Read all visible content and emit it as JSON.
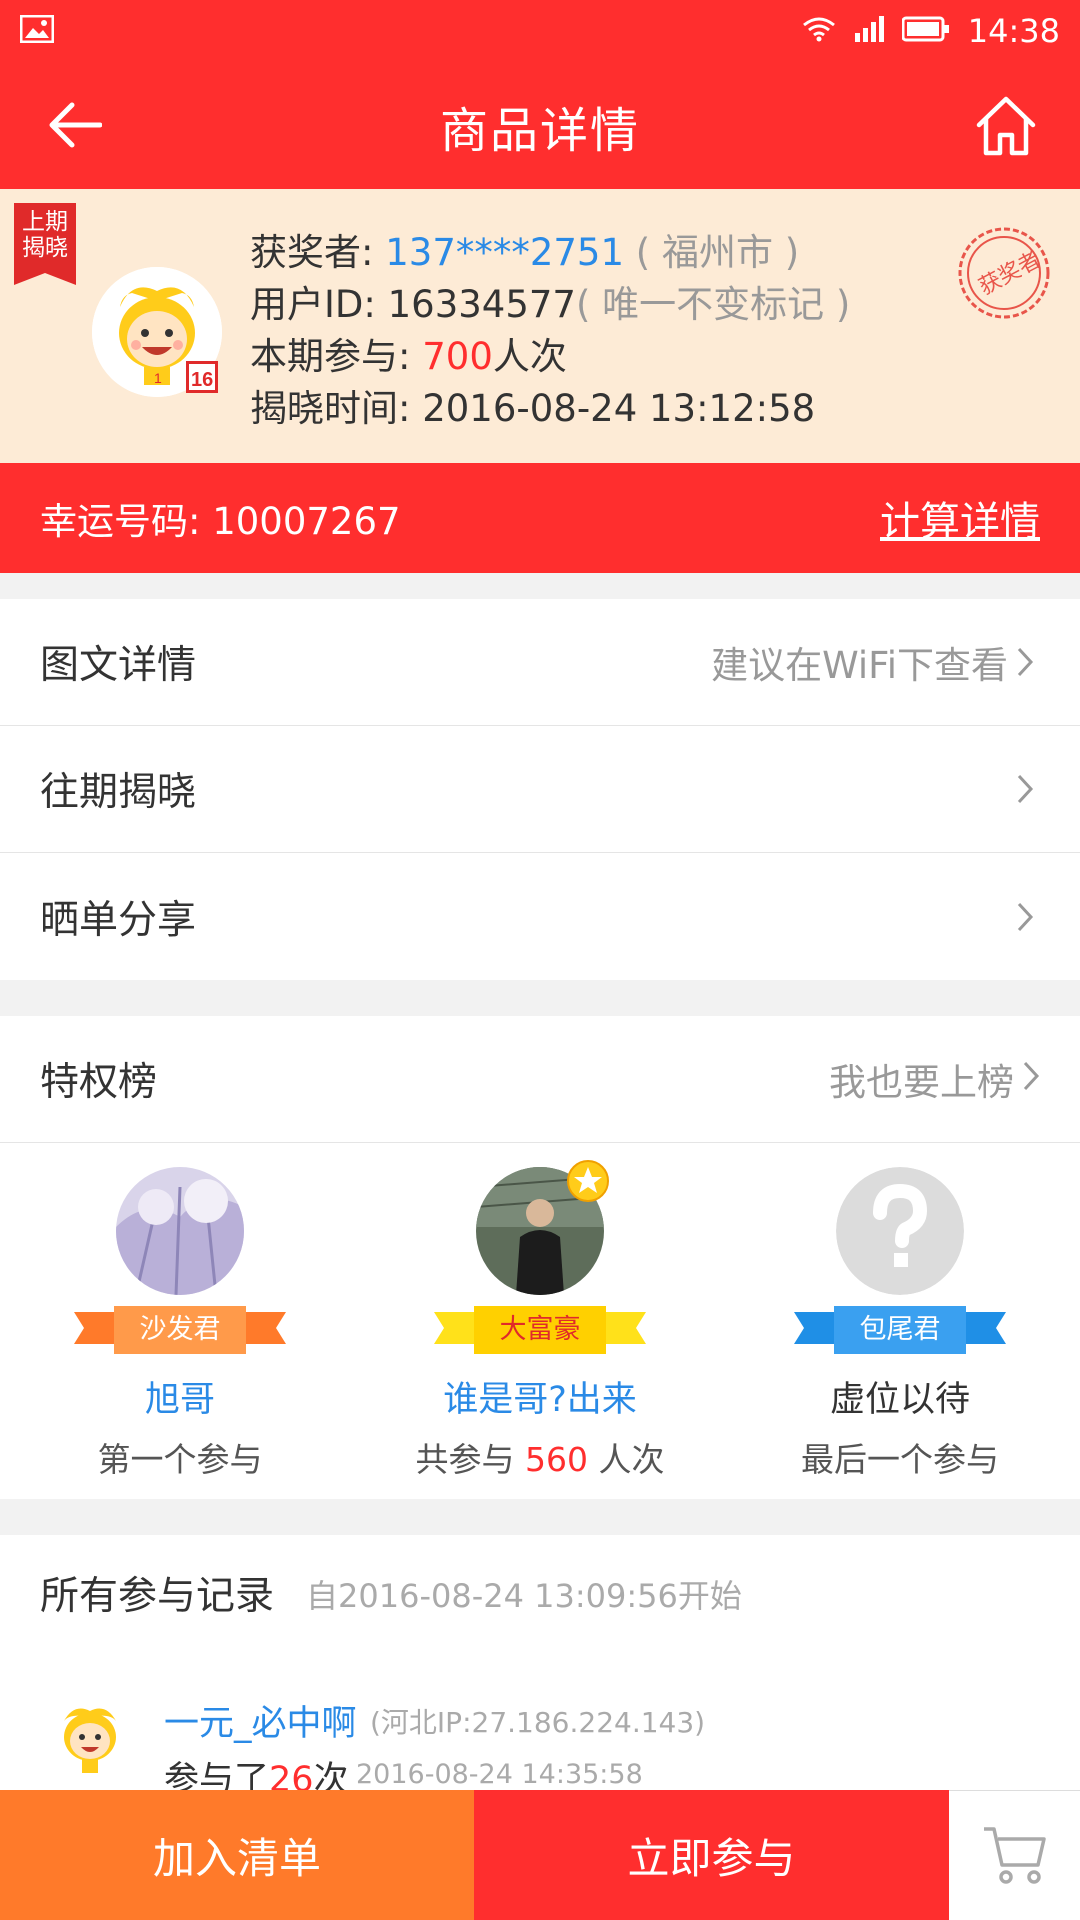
{
  "status_bar": {
    "time": "14:38",
    "icons": [
      "image-icon",
      "wifi-icon",
      "signal-icon",
      "battery-icon"
    ]
  },
  "header": {
    "title": "商品详情"
  },
  "winner": {
    "corner_tag_line1": "上期",
    "corner_tag_line2": "揭晓",
    "winner_label": "获奖者: ",
    "winner_phone": "137****2751",
    "winner_city": " ( 福州市 )",
    "user_id_label": "用户ID: 16334577",
    "user_id_note": "( 唯一不变标记 )",
    "participation_label": "本期参与: ",
    "participation_count": "700",
    "participation_unit": "人次",
    "reveal_time": "揭晓时间: 2016-08-24 13:12:58",
    "stamp_text": "获奖者"
  },
  "lucky": {
    "label": "幸运号码: 10007267",
    "calc_link": "计算详情"
  },
  "menu": [
    {
      "label": "图文详情",
      "hint": "建议在WiFi下查看"
    },
    {
      "label": "往期揭晓",
      "hint": ""
    },
    {
      "label": "晒单分享",
      "hint": ""
    }
  ],
  "privilege": {
    "title": "特权榜",
    "hint": "我也要上榜",
    "ranks": [
      {
        "ribbon": "沙发君",
        "name": "旭哥",
        "desc": "第一个参与",
        "ribbon_color": "#ff7a2a",
        "name_color": "#2a8ae6"
      },
      {
        "ribbon": "大富豪",
        "name": "谁是哥?出来",
        "desc_prefix": "共参与 ",
        "desc_count": "560",
        "desc_suffix": " 人次",
        "ribbon_color": "#ffe11a",
        "name_color": "#2a8ae6"
      },
      {
        "ribbon": "包尾君",
        "name": "虚位以待",
        "desc": "最后一个参与",
        "ribbon_color": "#3aa0f0",
        "name_color": "#333333"
      }
    ]
  },
  "records": {
    "title": "所有参与记录",
    "since": "自2016-08-24 13:09:56开始",
    "items": [
      {
        "user": "一元_必中啊",
        "ip": "(河北IP:27.186.224.143)",
        "count_prefix": "参与了",
        "count": "26",
        "count_suffix": "次",
        "time": "2016-08-24 14:35:58"
      }
    ]
  },
  "bottom": {
    "add_label": "加入清单",
    "join_label": "立即参与"
  }
}
